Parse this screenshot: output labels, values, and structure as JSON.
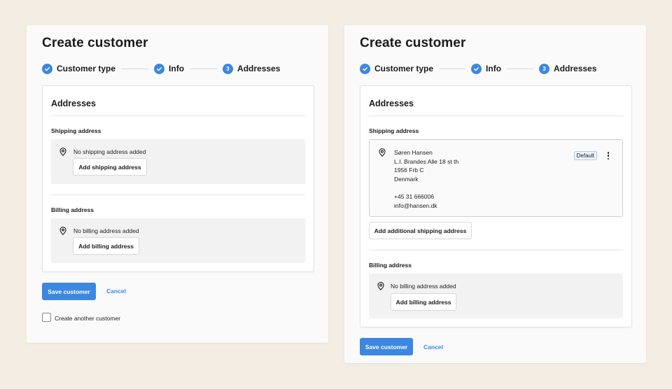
{
  "colors": {
    "accent": "#3d87e0",
    "background": "#f4ede3"
  },
  "left": {
    "title": "Create customer",
    "steps": [
      {
        "label": "Customer type",
        "state": "done"
      },
      {
        "label": "Info",
        "state": "done"
      },
      {
        "label": "Addresses",
        "state": "current",
        "number": "3"
      }
    ],
    "card_title": "Addresses",
    "shipping": {
      "label": "Shipping address",
      "empty_text": "No shipping address added",
      "button": "Add shipping address"
    },
    "billing": {
      "label": "Billing address",
      "empty_text": "No billing address added",
      "button": "Add billing address"
    },
    "save_label": "Save customer",
    "cancel_label": "Cancel",
    "checkbox_label": "Create another customer",
    "checkbox_checked": false
  },
  "right": {
    "title": "Create customer",
    "steps": [
      {
        "label": "Customer type",
        "state": "done"
      },
      {
        "label": "Info",
        "state": "done"
      },
      {
        "label": "Addresses",
        "state": "current",
        "number": "3"
      }
    ],
    "card_title": "Addresses",
    "shipping": {
      "label": "Shipping address",
      "address": {
        "name": "Søren Hansen",
        "street": "L.I. Brandes Alle 18 st th",
        "city": "1956 Frb C",
        "country": "Denmark",
        "phone": "+45 31 666006",
        "email": "info@hansen.dk"
      },
      "badge": "Default",
      "add_button": "Add additional shipping address"
    },
    "billing": {
      "label": "Billing address",
      "empty_text": "No billing address added",
      "button": "Add billing address"
    },
    "save_label": "Save customer",
    "cancel_label": "Cancel"
  }
}
